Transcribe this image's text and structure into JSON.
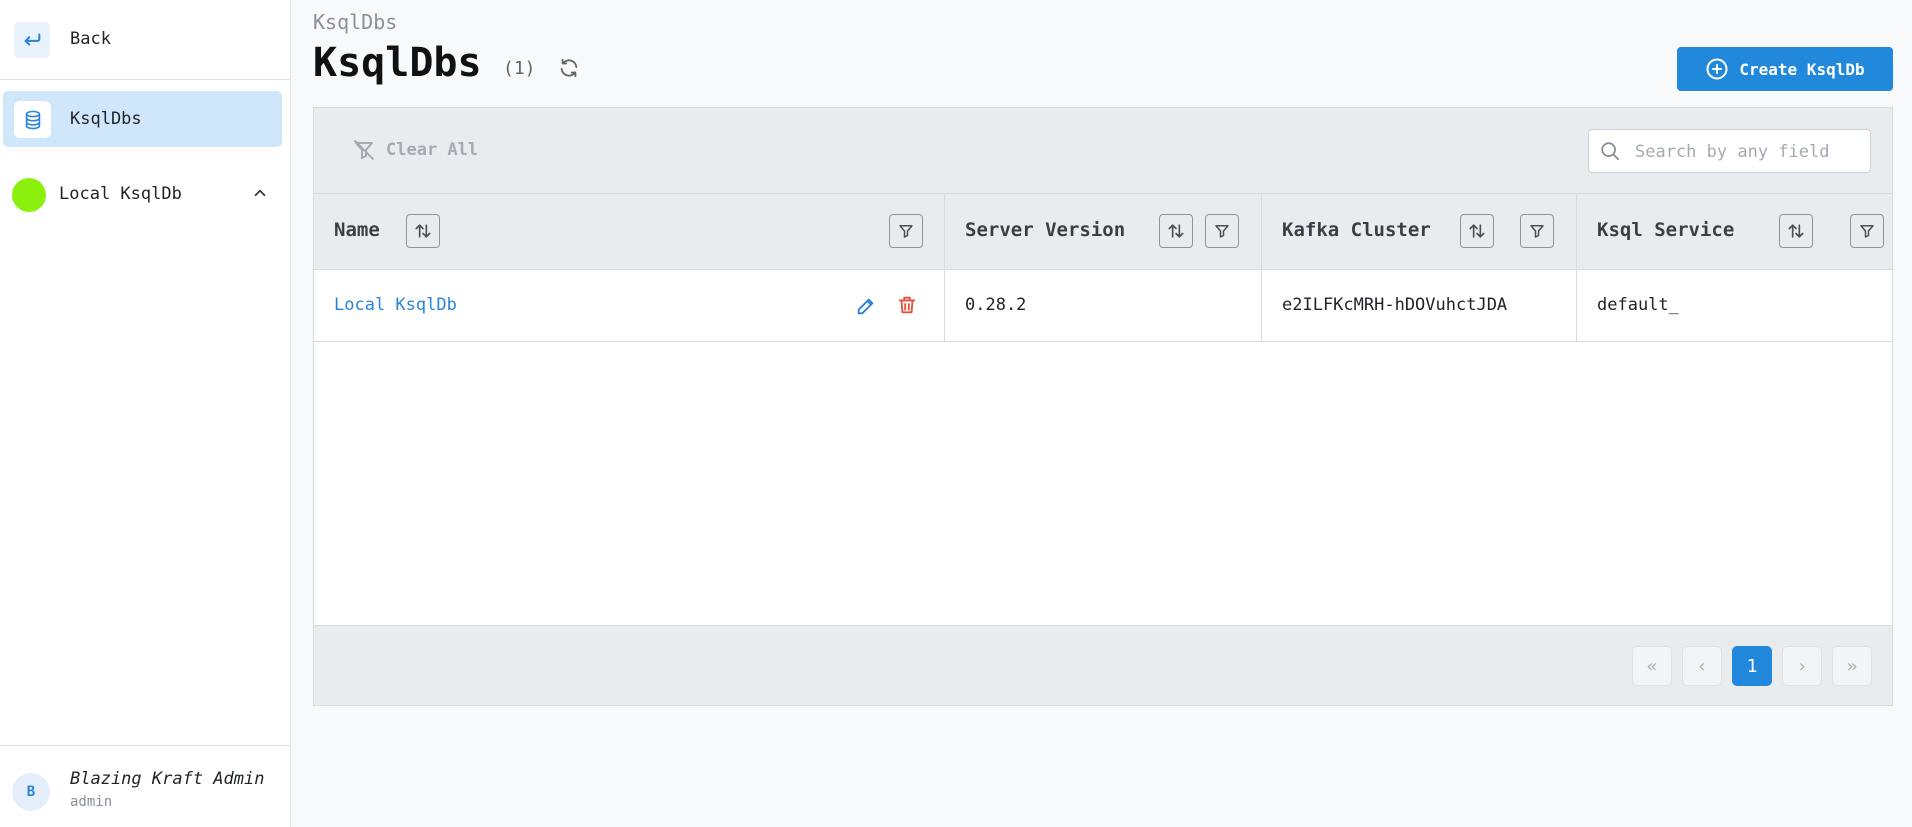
{
  "sidebar": {
    "back_label": "Back",
    "nav_active_label": "KsqlDbs",
    "cluster_label": "Local KsqlDb",
    "cluster_color": "#8bf00c",
    "user": {
      "initial": "B",
      "name": "Blazing Kraft Admin",
      "role": "admin"
    }
  },
  "header": {
    "breadcrumb": "KsqlDbs",
    "title": "KsqlDbs",
    "count": "(1)",
    "create_label": "Create KsqlDb"
  },
  "toolbar": {
    "clear_all_label": "Clear All",
    "search_placeholder": "Search by any field"
  },
  "table": {
    "columns": [
      "Name",
      "Server Version",
      "Kafka Cluster",
      "Ksql Service"
    ],
    "rows": [
      {
        "name": "Local KsqlDb",
        "server_version": "0.28.2",
        "kafka_cluster": "e2ILFKcMRH-hDOVuhctJDA",
        "ksql_service": "default_"
      }
    ]
  },
  "pagination": {
    "current_page": "1"
  },
  "colors": {
    "accent": "#2288dc",
    "danger": "#e0523d"
  },
  "icons": [
    "back-arrow-icon",
    "database-icon",
    "chevron-up-icon",
    "refresh-icon",
    "plus-circle-icon",
    "filter-clear-icon",
    "search-icon",
    "sort-icon",
    "filter-icon",
    "edit-icon",
    "delete-icon",
    "first-page-icon",
    "prev-page-icon",
    "next-page-icon",
    "last-page-icon"
  ]
}
